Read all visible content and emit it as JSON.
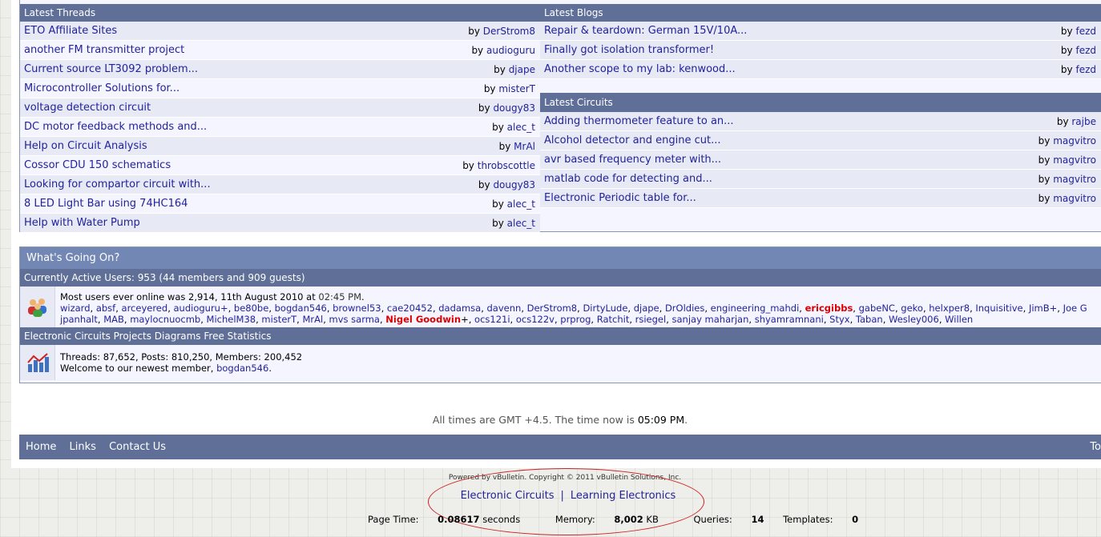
{
  "threads": {
    "header": "Latest Threads",
    "items": [
      {
        "title": "ETO Affiliate Sites",
        "by": "by",
        "user": "DerStrom8"
      },
      {
        "title": "another FM transmitter project",
        "by": "by",
        "user": "audioguru"
      },
      {
        "title": "Current source LT3092 problem...",
        "by": "by",
        "user": "djape"
      },
      {
        "title": "Microcontroller Solutions for...",
        "by": "by",
        "user": "misterT"
      },
      {
        "title": "voltage detection circuit",
        "by": "by",
        "user": "dougy83"
      },
      {
        "title": "DC motor feedback methods and...",
        "by": "by",
        "user": "alec_t"
      },
      {
        "title": "Help on Circuit Analysis",
        "by": "by",
        "user": "MrAl"
      },
      {
        "title": "Cossor CDU 150 schematics",
        "by": "by",
        "user": "throbscottle"
      },
      {
        "title": "Looking for compartor circuit with...",
        "by": "by",
        "user": "dougy83"
      },
      {
        "title": "8 LED Light Bar using 74HC164",
        "by": "by",
        "user": "alec_t"
      },
      {
        "title": "Help with Water Pump",
        "by": "by",
        "user": "alec_t"
      }
    ]
  },
  "blogs": {
    "header": "Latest Blogs",
    "items": [
      {
        "title": "Repair & teardown: German 15V/10A...",
        "by": "by",
        "user": "fezd"
      },
      {
        "title": "Finally got isolation transformer!",
        "by": "by",
        "user": "fezd"
      },
      {
        "title": "Another scope to my lab: kenwood...",
        "by": "by",
        "user": "fezd"
      }
    ]
  },
  "circuits": {
    "header": "Latest Circuits",
    "items": [
      {
        "title": "Adding thermometer feature to an...",
        "by": "by",
        "user": "rajbe"
      },
      {
        "title": "Alcohol detector and engine cut...",
        "by": "by",
        "user": "magvitro"
      },
      {
        "title": "avr based frequency meter with...",
        "by": "by",
        "user": "magvitro"
      },
      {
        "title": "matlab code for detecting and...",
        "by": "by",
        "user": "magvitro"
      },
      {
        "title": "Electronic Periodic table for...",
        "by": "by",
        "user": "magvitro"
      }
    ]
  },
  "wgo": {
    "title": "What's Going On?",
    "active_header": "Currently Active Users: 953 (44 members and 909 guests)",
    "most_users": "Most users ever online was 2,914, 11th August 2010 at",
    "most_time": "02:45 PM",
    "names_line1": [
      {
        "n": "wizard"
      },
      {
        "n": "absf"
      },
      {
        "n": "arceyered"
      },
      {
        "n": "audioguru+"
      },
      {
        "n": "be80be"
      },
      {
        "n": "bogdan546"
      },
      {
        "n": "brownel53"
      },
      {
        "n": "cae20452"
      },
      {
        "n": "dadamsa"
      },
      {
        "n": "davenn"
      },
      {
        "n": "DerStrom8"
      },
      {
        "n": "DirtyLude"
      },
      {
        "n": "djape"
      },
      {
        "n": "DrOldies"
      },
      {
        "n": "engineering_mahdi"
      },
      {
        "n": "ericgibbs",
        "mod": true
      },
      {
        "n": "gabeNC"
      },
      {
        "n": "geko"
      },
      {
        "n": "helxper8"
      },
      {
        "n": "Inquisitive"
      },
      {
        "n": "JimB+"
      },
      {
        "n": "Joe G"
      }
    ],
    "names_line2": [
      {
        "n": "jpanhalt"
      },
      {
        "n": "MAB"
      },
      {
        "n": "maylocnuocmb"
      },
      {
        "n": "MichelM38"
      },
      {
        "n": "misterT"
      },
      {
        "n": "MrAl"
      },
      {
        "n": "mvs sarma"
      },
      {
        "n": "Nigel Goodwin",
        "mod": true,
        "suffix": "+"
      },
      {
        "n": "ocs121i"
      },
      {
        "n": "ocs122v"
      },
      {
        "n": "prprog"
      },
      {
        "n": "Ratchit"
      },
      {
        "n": "rsiegel"
      },
      {
        "n": "sanjay maharjan"
      },
      {
        "n": "shyamramnani"
      },
      {
        "n": "Styx"
      },
      {
        "n": "Taban"
      },
      {
        "n": "Wesley006"
      },
      {
        "n": "Willen"
      }
    ],
    "stats_header": "Electronic Circuits Projects Diagrams Free Statistics",
    "stats_line": "Threads: 87,652, Posts: 810,250, Members: 200,452",
    "welcome": "Welcome to our newest member,",
    "newest": "bogdan546"
  },
  "times": {
    "text": "All times are GMT +4.5. The time now is",
    "now": "05:09 PM"
  },
  "nav": {
    "home": "Home",
    "links": "Links",
    "contact": "Contact Us",
    "top": "To"
  },
  "footer": {
    "powered": "Powered by vBulletin. Copyright © 2011 vBulletin Solutions, Inc.",
    "link1": "Electronic Circuits",
    "sep": "|",
    "link2": "Learning Electronics",
    "page_time_label": "Page Time:",
    "page_time": "0.08617",
    "page_time_unit": "seconds",
    "memory_label": "Memory:",
    "memory": "8,002",
    "memory_unit": "KB",
    "queries_label": "Queries:",
    "queries": "14",
    "templates_label": "Templates:",
    "templates": "0"
  },
  "colors": {
    "header": "#5f6f97",
    "link": "#22229c",
    "mod": "#dd0000",
    "annotation": "#cc2222"
  }
}
